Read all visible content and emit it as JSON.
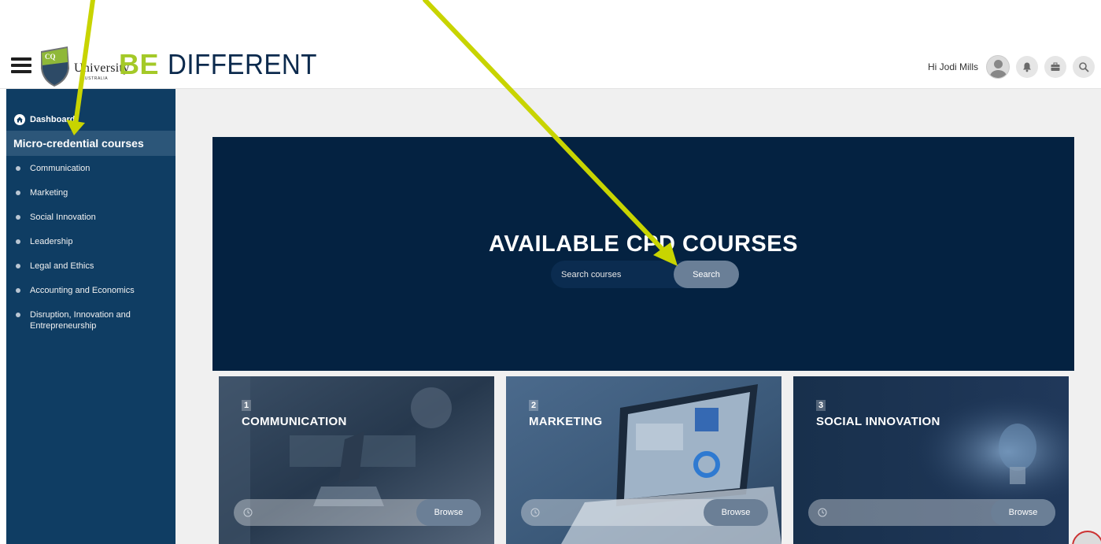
{
  "header": {
    "logo": {
      "university": "University",
      "country": "AUSTRALIA",
      "initials": "CQ"
    },
    "tagline_bold": "BE",
    "tagline_rest": "DIFFERENT",
    "greeting": "Hi Jodi Mills"
  },
  "sidebar": {
    "dashboard_label": "Dashboard",
    "section_label": "Micro-credential courses",
    "items": [
      {
        "label": "Communication"
      },
      {
        "label": "Marketing"
      },
      {
        "label": "Social Innovation"
      },
      {
        "label": "Leadership"
      },
      {
        "label": "Legal and Ethics"
      },
      {
        "label": "Accounting and Economics"
      },
      {
        "label": "Disruption, Innovation and Entrepreneurship"
      }
    ]
  },
  "hero": {
    "title": "AVAILABLE CPD COURSES",
    "search_placeholder": "Search courses",
    "search_button": "Search"
  },
  "cards": [
    {
      "number": "1",
      "title": "COMMUNICATION",
      "button": "Browse"
    },
    {
      "number": "2",
      "title": "MARKETING",
      "button": "Browse"
    },
    {
      "number": "3",
      "title": "SOCIAL INNOVATION",
      "button": "Browse"
    }
  ],
  "colors": {
    "sidebar_bg": "#0f3d63",
    "hero_bg": "#042241",
    "accent_green": "#a4c928",
    "button_grey": "#6a7f97",
    "annotation_arrow": "#c8d400"
  },
  "icons": {
    "menu": "hamburger-icon",
    "notifications": "bell-icon",
    "messages": "briefcase-icon",
    "search": "search-icon",
    "home": "home-icon",
    "clock": "clock-icon"
  }
}
